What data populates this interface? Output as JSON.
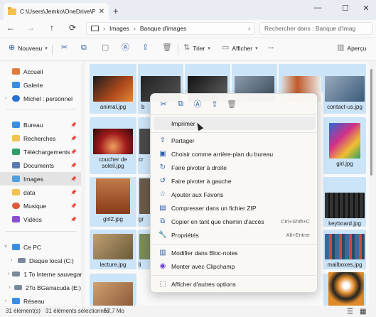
{
  "window": {
    "tab_title": "C:\\Users\\Jemko\\OneDrive\\Pict",
    "tab_close": "✕",
    "new_tab": "+",
    "minimize": "—",
    "maximize": "☐",
    "close": "✕"
  },
  "address": {
    "back": "←",
    "forward": "→",
    "up": "↑",
    "refresh": "⟳",
    "crumbs": [
      "Images",
      "Banque d'images"
    ],
    "search_placeholder": "Rechercher dans : Banque d'imag"
  },
  "toolbar": {
    "new_label": "Nouveau",
    "sort_label": "Trier",
    "view_label": "Afficher",
    "more_label": "···",
    "preview_label": "Aperçu"
  },
  "sidebar": {
    "items": [
      {
        "label": "Accueil",
        "color": "#e07a3a"
      },
      {
        "label": "Galerie",
        "color": "#3a8ee0"
      },
      {
        "label": "Michel : personnel",
        "color": "#2a6fd6"
      },
      {
        "label": "Bureau",
        "color": "#3a8ee0"
      },
      {
        "label": "Recherches",
        "color": "#f2c14e"
      },
      {
        "label": "Téléchargements",
        "color": "#2e9e6b"
      },
      {
        "label": "Documents",
        "color": "#5a7ab0"
      },
      {
        "label": "Images",
        "color": "#4f9fe0"
      },
      {
        "label": "data",
        "color": "#f2c14e"
      },
      {
        "label": "Musique",
        "color": "#e05a3a"
      },
      {
        "label": "Vidéos",
        "color": "#8a4fd0"
      },
      {
        "label": "Ce PC",
        "color": "#3a8ee0"
      },
      {
        "label": "Disque local (C:)",
        "color": "#7a8a9a"
      },
      {
        "label": "1 To Interne sauvegar",
        "color": "#7a8a9a"
      },
      {
        "label": "2To BGarracuda (E:)",
        "color": "#7a8a9a"
      },
      {
        "label": "Réseau",
        "color": "#3a8ee0"
      }
    ],
    "pin": "📌"
  },
  "files": [
    {
      "name": "animal.jpg",
      "color": "#b04a1c"
    },
    {
      "name": "b",
      "color": "#3a3a3a"
    },
    {
      "name": "",
      "color": "#2e2e2e"
    },
    {
      "name": "",
      "color": "#5a6a7a"
    },
    {
      "name": "",
      "color": "#8a3a1a"
    },
    {
      "name": "",
      "color": "#6a4a2a"
    },
    {
      "name": "contact-us.jpg",
      "color": "#3a5a7a"
    },
    {
      "name": "coucher de soleil.jpg",
      "color": "#7a1a1a"
    },
    {
      "name": "cr",
      "color": "#4a4a4a"
    },
    {
      "name": "girl.jpg",
      "color": "#5a3a8a"
    },
    {
      "name": "girl2.jpg",
      "color": "#c06a4a"
    },
    {
      "name": "gr",
      "color": "#6a5a4a"
    },
    {
      "name": "keyboard.jpg",
      "color": "#2a2a2a"
    },
    {
      "name": "lecture.jpg",
      "color": "#8a7a5a"
    },
    {
      "name": "li",
      "color": "#7a8a5a"
    },
    {
      "name": "mailboxes.jpg",
      "color": "#3a6a9a"
    },
    {
      "name": "",
      "color": "#a06a4a"
    },
    {
      "name": "",
      "color": "#c07a2a"
    }
  ],
  "context_menu": {
    "quick_actions": [
      "✂",
      "⧉",
      "Ⓐ",
      "⇪",
      "🗑"
    ],
    "items": [
      {
        "icon": "",
        "label": "Imprimer",
        "shortcut": ""
      },
      {
        "icon": "⇪",
        "label": "Partager",
        "shortcut": ""
      },
      {
        "icon": "▣",
        "label": "Choisir comme arrière-plan du bureau",
        "shortcut": ""
      },
      {
        "icon": "↻",
        "label": "Faire pivoter à droite",
        "shortcut": ""
      },
      {
        "icon": "↺",
        "label": "Faire pivoter à gauche",
        "shortcut": ""
      },
      {
        "icon": "☆",
        "label": "Ajouter aux Favoris",
        "shortcut": ""
      },
      {
        "icon": "▤",
        "label": "Compresser dans un fichier ZIP",
        "shortcut": ""
      },
      {
        "icon": "⧉",
        "label": "Copier en tant que chemin d'accès",
        "shortcut": "Ctrl+Shift+C"
      },
      {
        "icon": "🔧",
        "label": "Propriétés",
        "shortcut": "Alt+Entrer"
      },
      {
        "icon": "▥",
        "label": "Modifier dans Bloc-notes",
        "shortcut": ""
      },
      {
        "icon": "◉",
        "label": "Monter avec Clipchamp",
        "shortcut": ""
      },
      {
        "icon": "⬚",
        "label": "Afficher d'autres options",
        "shortcut": ""
      }
    ]
  },
  "status": {
    "count": "31 élément(s)",
    "selected": "31 éléments sélectionnés",
    "size": "57,7 Mo"
  }
}
